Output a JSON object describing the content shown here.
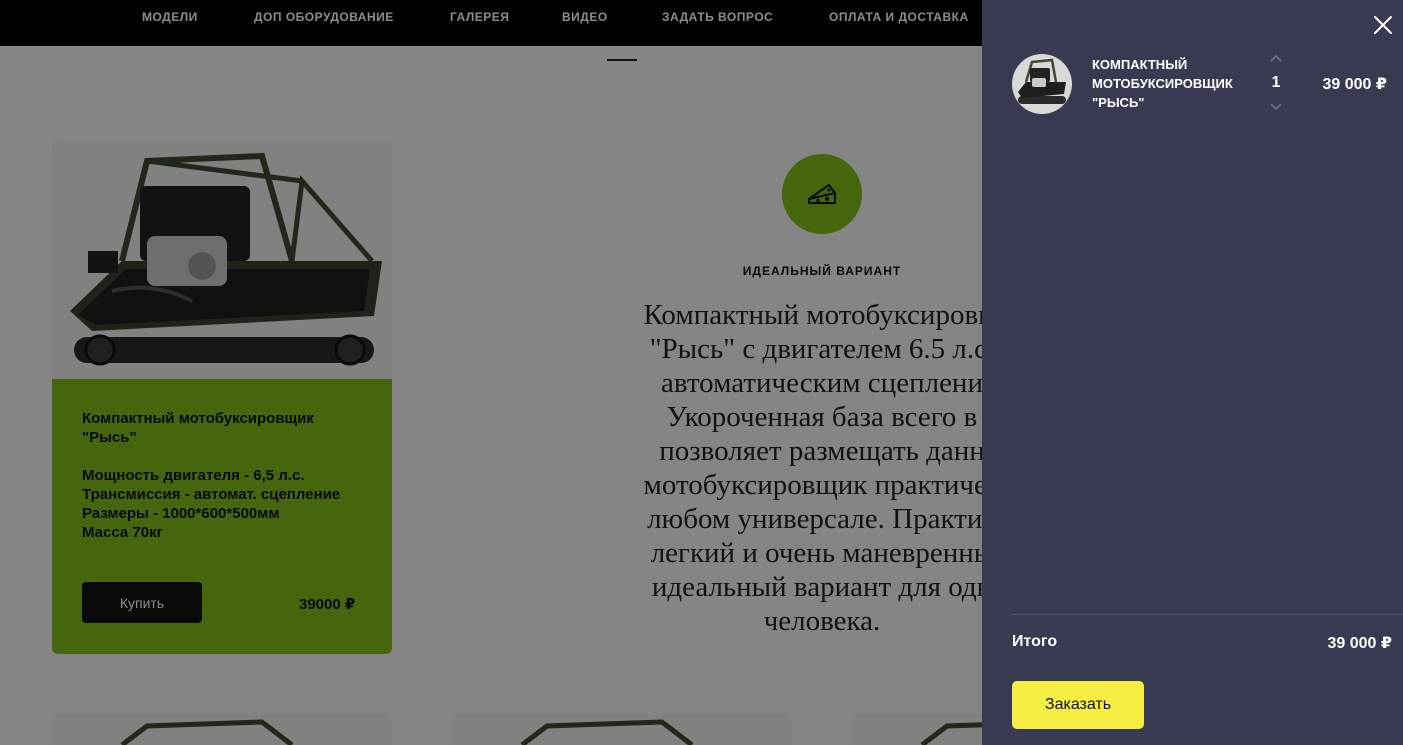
{
  "nav": {
    "items": [
      {
        "label": "МОДЕЛИ"
      },
      {
        "label": "ДОП ОБОРУДОВАНИЕ"
      },
      {
        "label": "ГАЛЕРЕЯ"
      },
      {
        "label": "ВИДЕО"
      },
      {
        "label": "ЗАДАТЬ ВОПРОС"
      },
      {
        "label": "ОПЛАТА И ДОСТАВКА"
      }
    ]
  },
  "product_card": {
    "title": "Компактный мотобуксировщик \"Рысь\"",
    "specs": [
      "Мощность двигателя - 6,5 л.с.",
      "Трансмиссия - автомат. сцепление",
      "Размеры - 1000*600*500мм",
      "Масса 70кг"
    ],
    "buy_label": "Купить",
    "price": "39000 ₽"
  },
  "feature": {
    "icon": "cheese-icon",
    "label": "ИДЕАЛЬНЫЙ ВАРИАНТ",
    "lines": [
      "Компактный мотобуксировщ",
      "\"Рысь\" с двигателем 6.5 л.с.",
      "автоматическим сцеплени",
      "Укороченная база всего в",
      "позволяет размещать данн",
      "мотобуксировщик практичес",
      "любом универсале. Практич",
      "легкий и очень маневренны",
      "идеальный вариант для одн",
      "человека."
    ]
  },
  "cart": {
    "item": {
      "name": "Компактный мотобуксировщик \"Рысь\"",
      "quantity": "1",
      "price": "39 000 ₽"
    },
    "total_label": "Итого",
    "total_value": "39 000 ₽",
    "order_label": "Заказать"
  },
  "colors": {
    "accent_green": "#7ebb17",
    "cart_bg": "#373a50",
    "order_button": "#f5ed41"
  }
}
